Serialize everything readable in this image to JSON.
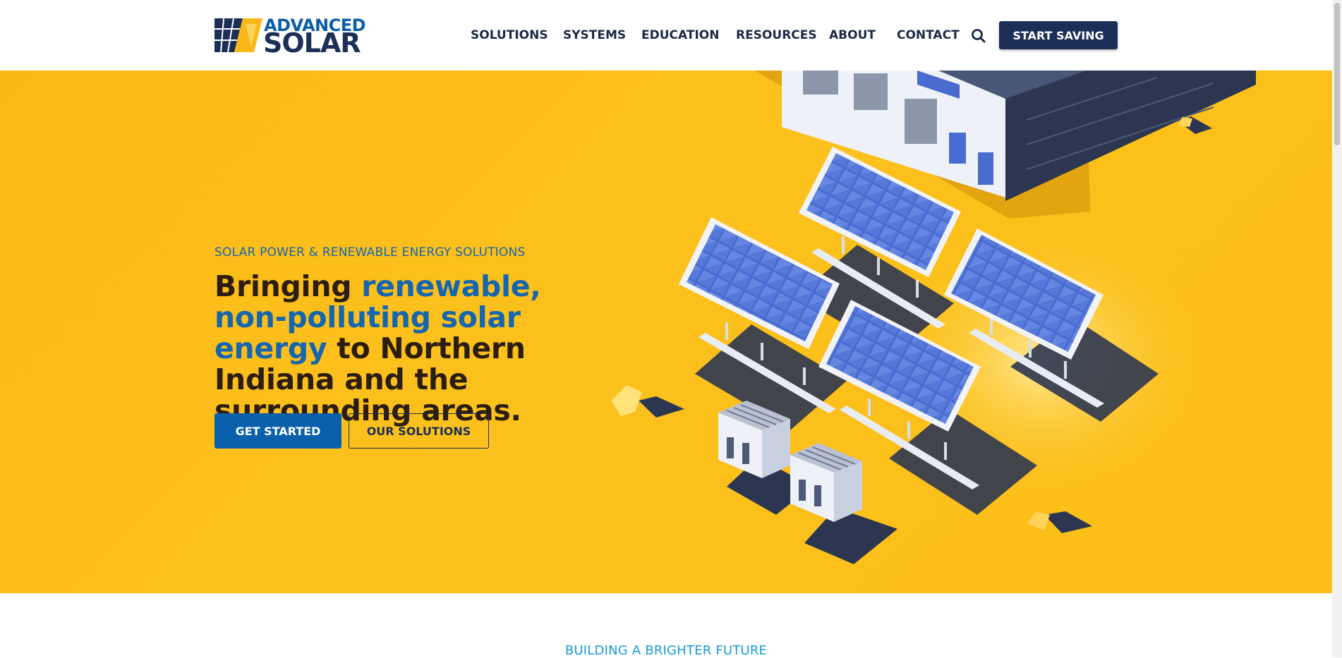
{
  "brand": {
    "logo_line1": "ADVANCED",
    "logo_line2": "SOLAR",
    "colors": {
      "navy": "#1b2f57",
      "blue": "#0b60ac",
      "yellow": "#fcbe19",
      "light_blue": "#1a9bd7"
    }
  },
  "nav": {
    "items": [
      "SOLUTIONS",
      "SYSTEMS",
      "EDUCATION",
      "RESOURCES",
      "ABOUT",
      "CONTACT"
    ],
    "search_icon": "search-icon",
    "cta_label": "START SAVING"
  },
  "hero": {
    "eyebrow": "SOLAR POWER & RENEWABLE ENERGY SOLUTIONS",
    "headline_part1": "Bringing ",
    "headline_highlight": "renewable, non-polluting solar energy",
    "headline_part2": " to Northern Indiana and the surrounding areas.",
    "primary_button": "GET STARTED",
    "secondary_button": "OUR SOLUTIONS"
  },
  "next_section": {
    "eyebrow": "BUILDING A BRIGHTER FUTURE"
  }
}
